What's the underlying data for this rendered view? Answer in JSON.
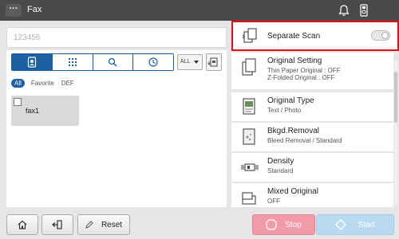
{
  "header": {
    "menu_label": "···",
    "title": "Fax",
    "icons": [
      "bell-icon",
      "usb-memory-icon"
    ]
  },
  "destination": {
    "value": "123456"
  },
  "address_book": {
    "tabs": [
      "address-book-icon",
      "keypad-icon",
      "search-icon",
      "history-icon"
    ],
    "all_dropdown": "ALL",
    "filters": [
      "All",
      "Favorite",
      "DEF"
    ],
    "entries": [
      {
        "name": "fax1"
      }
    ]
  },
  "settings": {
    "separate_scan": {
      "title": "Separate Scan",
      "enabled": false
    },
    "items": [
      {
        "title": "Original Setting",
        "sub1": "Thin Paper Original : OFF",
        "sub2": "Z-Folded Original : OFF"
      },
      {
        "title": "Original Type",
        "sub1": "Text / Photo",
        "sub2": ""
      },
      {
        "title": "Bkgd.Removal",
        "sub1": "Bleed Removal / Standard",
        "sub2": ""
      },
      {
        "title": "Density",
        "sub1": "Standard",
        "sub2": ""
      },
      {
        "title": "Mixed Original",
        "sub1": "OFF",
        "sub2": ""
      }
    ]
  },
  "bottom": {
    "reset_label": "Reset",
    "stop_label": "Stop",
    "start_label": "Start"
  },
  "colors": {
    "accent": "#1c5fa3",
    "highlight_border": "#e01010",
    "stop": "#f39aa8",
    "start": "#b9dbf1"
  }
}
